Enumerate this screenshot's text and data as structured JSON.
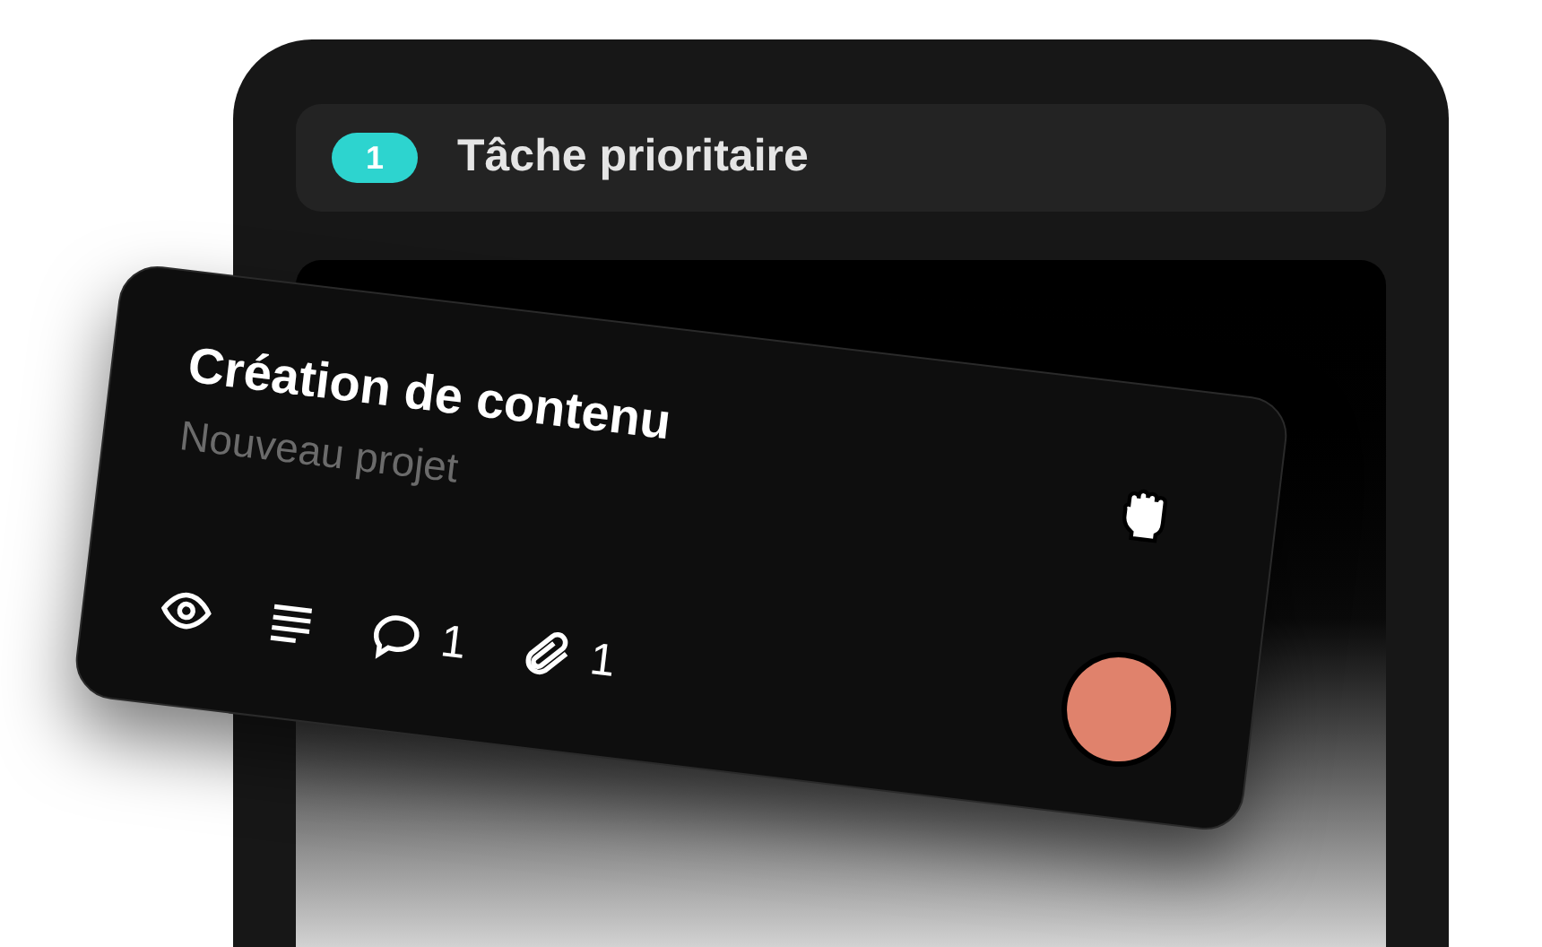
{
  "column": {
    "count": "1",
    "title": "Tâche prioritaire"
  },
  "card": {
    "title": "Création de contenu",
    "subtitle": "Nouveau projet",
    "comments": "1",
    "attachments": "1"
  }
}
